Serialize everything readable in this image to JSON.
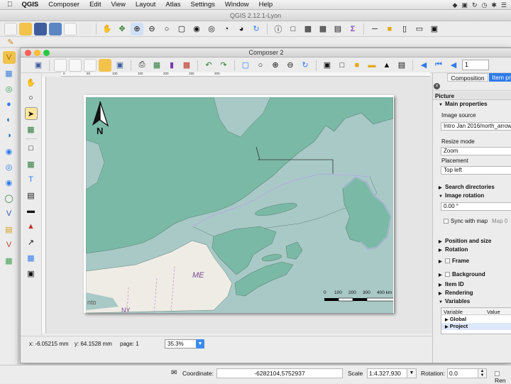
{
  "menubar": {
    "app": "QGIS",
    "items": [
      "Composer",
      "Edit",
      "View",
      "Layout",
      "Atlas",
      "Settings",
      "Window",
      "Help"
    ]
  },
  "main_window": {
    "title": "QGIS 2.12.1-Lyon"
  },
  "composer": {
    "title": "Composer 2",
    "page_value": "1",
    "map": {
      "north_label": "N",
      "state_label": "ME",
      "scale_ticks": [
        "0",
        "100",
        "200",
        "300",
        "400 km"
      ],
      "city_label": "nto",
      "state_label2": "NY"
    },
    "status": {
      "x": "x: -6.05215 mm",
      "y": "y: 64.1528 mm",
      "page": "page: 1",
      "zoom": "35.3%"
    },
    "ruler_marks": [
      "0",
      "50",
      "100",
      "150",
      "200",
      "250",
      "300"
    ]
  },
  "panel": {
    "tabs": [
      "Composition",
      "Item pro"
    ],
    "header": "Picture",
    "main_properties": "Main properties",
    "image_source_label": "Image source",
    "image_source_value": "Intro Jan 2016/north_arrow_",
    "resize_mode_label": "Resize mode",
    "resize_mode_value": "Zoom",
    "placement_label": "Placement",
    "placement_value": "Top left",
    "search_directories": "Search directories",
    "image_rotation": "Image rotation",
    "rotation_value": "0.00 °",
    "sync_with_map": "Sync with map",
    "sync_map_value": "Map 0",
    "sections": [
      "Position and size",
      "Rotation",
      "Frame",
      "Background",
      "Item ID",
      "Rendering",
      "Variables"
    ],
    "variables_header": [
      "Variable",
      "Value"
    ],
    "variables_rows": [
      "Global",
      "Project"
    ]
  },
  "main_status": {
    "coordinate_label": "Coordinate:",
    "coordinate_value": "-6282104,5752937",
    "scale_label": "Scale",
    "scale_value": "1:4,327,930",
    "rotation_label": "Rotation:",
    "rotation_value": "0.0",
    "render_label": "Ren"
  },
  "colors": {
    "land_canada": "#7ab9a6",
    "water": "#a8c9c6",
    "land_us": "#efece6",
    "accent": "#2f7be8"
  }
}
